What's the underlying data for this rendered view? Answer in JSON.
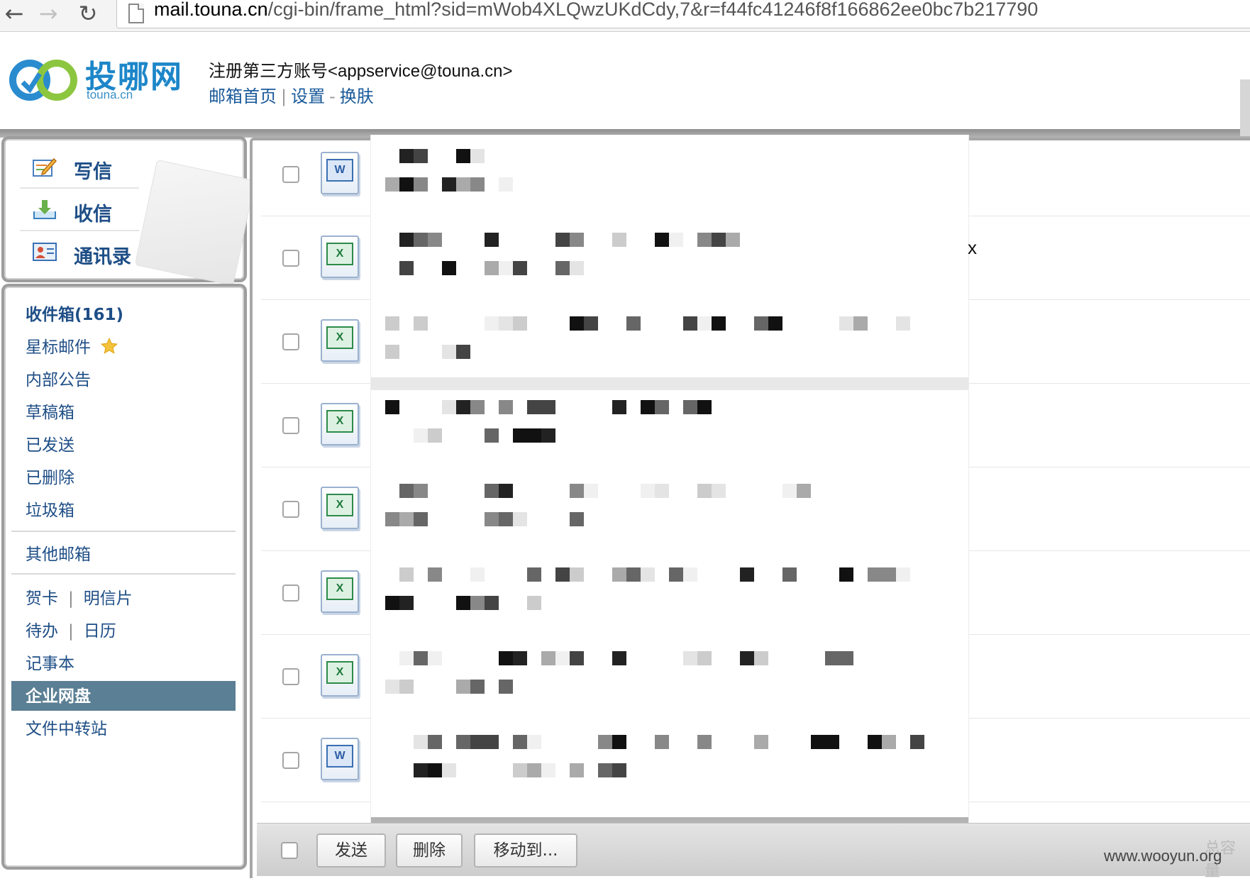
{
  "browser": {
    "url_host": "mail.touna.cn",
    "url_path": "/cgi-bin/frame_html?sid=mWob4XLQwzUKdCdy,7&r=f44fc41246f8f166862ee0bc7b217790",
    "back_glyph": "←",
    "forward_glyph": "→",
    "reload_glyph": "↻"
  },
  "header": {
    "logo_text": "投哪网",
    "logo_sub": "touna.cn",
    "account": "注册第三方账号<appservice@touna.cn>",
    "links": {
      "home": "邮箱首页",
      "settings": "设置",
      "dash": "-",
      "skin": "换肤",
      "pipe": "|"
    }
  },
  "quick": {
    "compose": "写信",
    "inbox_check": "收信",
    "contacts": "通讯录"
  },
  "folders": {
    "inbox": "收件箱(161)",
    "starred": "星标邮件",
    "notice": "内部公告",
    "drafts": "草稿箱",
    "sent": "已发送",
    "deleted": "已删除",
    "junk": "垃圾箱",
    "other": "其他邮箱",
    "card": "贺卡",
    "postcard": "明信片",
    "todo": "待办",
    "calendar": "日历",
    "notes": "记事本",
    "netdisk": "企业网盘",
    "transfer": "文件中转站",
    "pipe": "|"
  },
  "files": [
    {
      "type": "word",
      "glyph": "W"
    },
    {
      "type": "excel",
      "glyph": "X"
    },
    {
      "type": "excel",
      "glyph": "X"
    },
    {
      "type": "excel",
      "glyph": "X"
    },
    {
      "type": "excel",
      "glyph": "X"
    },
    {
      "type": "excel",
      "glyph": "X"
    },
    {
      "type": "excel",
      "glyph": "X"
    },
    {
      "type": "word",
      "glyph": "W"
    }
  ],
  "stray_mark": "x",
  "toolbar": {
    "send": "发送",
    "delete": "删除",
    "move": "移动到..."
  },
  "capacity_label": "总容量",
  "watermark": "www.wooyun.org"
}
